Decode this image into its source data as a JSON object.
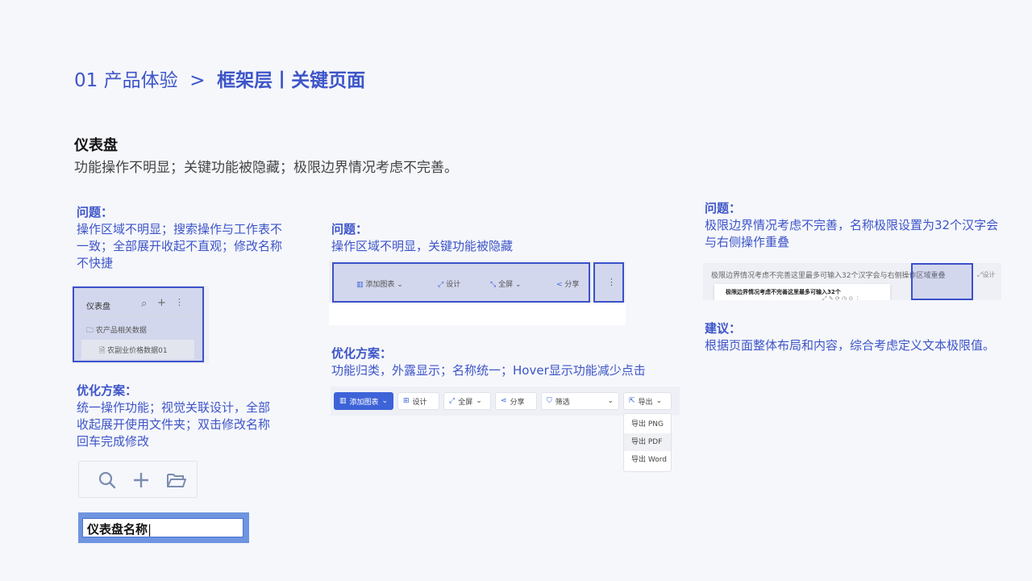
{
  "header": {
    "prefix": "01 产品体验  >  ",
    "title": "框架层丨关键页面"
  },
  "section": {
    "title": "仪表盘",
    "subtitle": "功能操作不明显；关键功能被隐藏；极限边界情况考虑不完善。"
  },
  "col1": {
    "problem_title": "问题：",
    "problem_text": "操作区域不明显；搜索操作与工作表不一致；全部展开收起不直观；修改名称不快捷",
    "shot": {
      "title": "仪表盘",
      "folder": "农产品相关数据",
      "file": "农副业价格数据01"
    },
    "solution_title": "优化方案：",
    "solution_text": "统一操作功能；视觉关联设计，全部收起展开使用文件夹；双击修改名称回车完成修改",
    "rename_value": "仪表盘名称",
    "colors": {
      "highlight": "#3b51c9"
    }
  },
  "col2": {
    "problem_title": "问题：",
    "problem_text": "操作区域不明显，关键功能被隐藏",
    "toolbar_old": {
      "add_chart": "添加图表",
      "design": "设计",
      "fullscreen": "全屏",
      "share": "分享"
    },
    "solution_title": "优化方案：",
    "solution_text": "功能归类，外露显示；名称统一；Hover显示功能减少点击",
    "toolbar_new": {
      "add_chart": "添加图表",
      "design": "设计",
      "fullscreen": "全屏",
      "share": "分享",
      "filter": "筛选",
      "export": "导出",
      "export_options": [
        "导出 PNG",
        "导出 PDF",
        "导出 Word"
      ]
    }
  },
  "col3": {
    "problem_title": "问题：",
    "problem_text": "极限边界情况考虑不完善，名称极限设置为32个汉字会与右侧操作重叠",
    "shot": {
      "long_name": "极限边界情况考虑不完善这里最多可输入32个汉字会与右侧操作区域重叠",
      "tooltip": "极限边界情况考虑不完善这里最多可输入32个",
      "design": "设计"
    },
    "suggestion_title": "建议：",
    "suggestion_text": "根据页面整体布局和内容，综合考虑定义文本极限值。"
  }
}
